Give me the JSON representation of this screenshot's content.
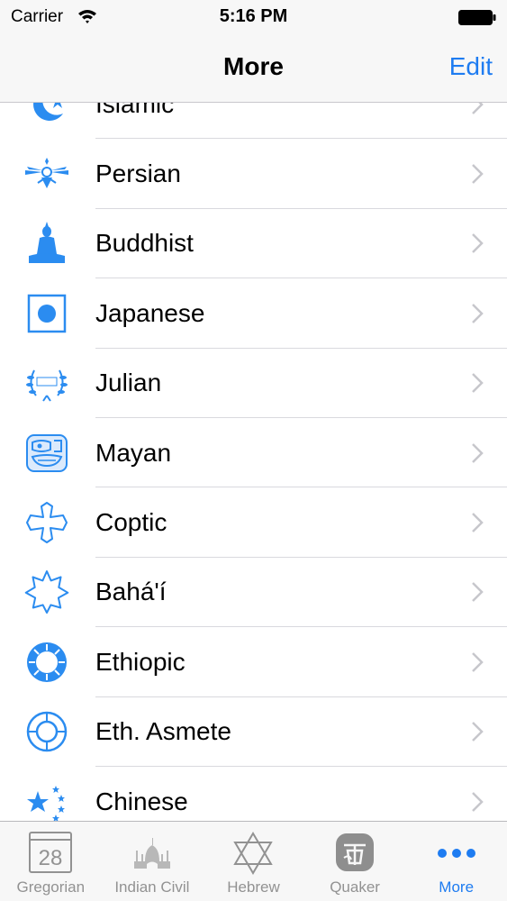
{
  "status_bar": {
    "carrier": "Carrier",
    "time": "5:16 PM"
  },
  "nav": {
    "title": "More",
    "edit_label": "Edit"
  },
  "colors": {
    "accent": "#1e7cf1",
    "inactive": "#929292",
    "separator": "#d9d9de"
  },
  "list": {
    "items": [
      {
        "label": "Islamic",
        "icon": "crescent-star-icon"
      },
      {
        "label": "Persian",
        "icon": "faravahar-icon"
      },
      {
        "label": "Buddhist",
        "icon": "buddha-icon"
      },
      {
        "label": "Japanese",
        "icon": "rising-sun-flag-icon"
      },
      {
        "label": "Julian",
        "icon": "spqr-laurel-icon"
      },
      {
        "label": "Mayan",
        "icon": "mayan-glyph-icon"
      },
      {
        "label": "Coptic",
        "icon": "coptic-cross-icon"
      },
      {
        "label": "Bahá'í",
        "icon": "nine-point-star-icon"
      },
      {
        "label": "Ethiopic",
        "icon": "sunburst-icon"
      },
      {
        "label": "Eth. Asmete",
        "icon": "ring-icon"
      },
      {
        "label": "Chinese",
        "icon": "chinese-stars-icon"
      }
    ]
  },
  "tabs": [
    {
      "label": "Gregorian",
      "icon": "calendar-icon",
      "date": "28",
      "active": false
    },
    {
      "label": "Indian Civil",
      "icon": "taj-mahal-icon",
      "active": false
    },
    {
      "label": "Hebrew",
      "icon": "star-of-david-icon",
      "active": false
    },
    {
      "label": "Quaker",
      "icon": "quaker-seal-icon",
      "active": false
    },
    {
      "label": "More",
      "icon": "more-dots-icon",
      "active": true
    }
  ]
}
